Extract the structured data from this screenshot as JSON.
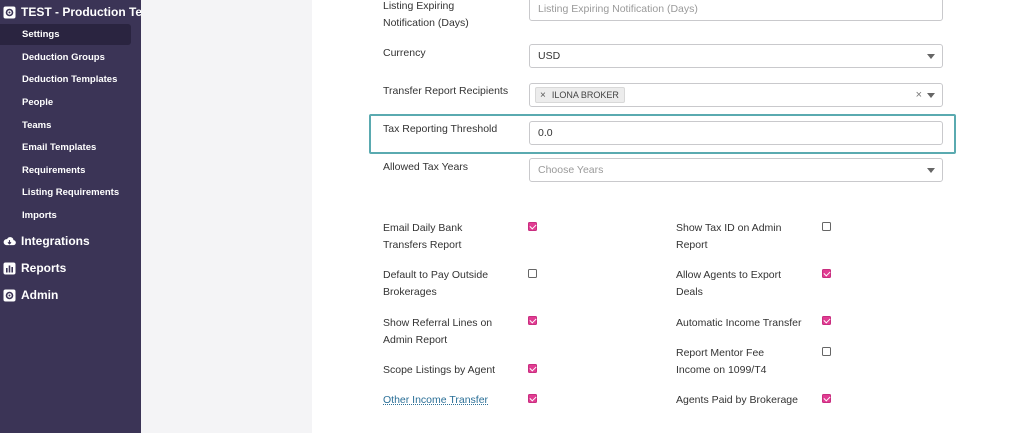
{
  "sidebar": {
    "org_title": "TEST - Production Test",
    "items": [
      {
        "label": "Settings",
        "active": true
      },
      {
        "label": "Deduction Groups"
      },
      {
        "label": "Deduction Templates"
      },
      {
        "label": "People"
      },
      {
        "label": "Teams"
      },
      {
        "label": "Email Templates"
      },
      {
        "label": "Requirements"
      },
      {
        "label": "Listing Requirements"
      },
      {
        "label": "Imports"
      }
    ],
    "sections": [
      {
        "label": "Integrations",
        "icon": "cloud-icon"
      },
      {
        "label": "Reports",
        "icon": "bar-chart-icon"
      },
      {
        "label": "Admin",
        "icon": "gear-icon"
      }
    ]
  },
  "form": {
    "listing_expiring": {
      "label": "Listing Expiring Notification (Days)",
      "placeholder": "Listing Expiring Notification (Days)"
    },
    "currency": {
      "label": "Currency",
      "value": "USD"
    },
    "transfer_report": {
      "label": "Transfer Report Recipients",
      "tag": "ILONA BROKER",
      "tag_remove": "×",
      "clear": "×"
    },
    "tax_threshold": {
      "label": "Tax Reporting Threshold",
      "value": "0.0"
    },
    "allowed_tax_years": {
      "label": "Allowed Tax Years",
      "placeholder": "Choose Years"
    }
  },
  "options_left": [
    {
      "label": "Email Daily Bank Transfers Report",
      "checked": true
    },
    {
      "label": "Default to Pay Outside Brokerages",
      "checked": false
    },
    {
      "label": "Show Referral Lines on Admin Report",
      "checked": true
    },
    {
      "label": "Scope Listings by Agent",
      "checked": true
    },
    {
      "label": "Other Income Transfer",
      "checked": true,
      "link": true
    }
  ],
  "options_right": [
    {
      "label": "Show Tax ID on Admin Report",
      "checked": false
    },
    {
      "label": "Allow Agents to Export Deals",
      "checked": true
    },
    {
      "label": "Automatic Income Transfer",
      "checked": true
    },
    {
      "label": "Report Mentor Fee Income on 1099/T4",
      "checked": false
    },
    {
      "label": "Agents Paid by Brokerage",
      "checked": true
    }
  ],
  "colors": {
    "sidebar_bg": "#3b3456",
    "accent_pink": "#e13c92",
    "highlight": "#5aaab0",
    "link": "#2a6f97"
  }
}
